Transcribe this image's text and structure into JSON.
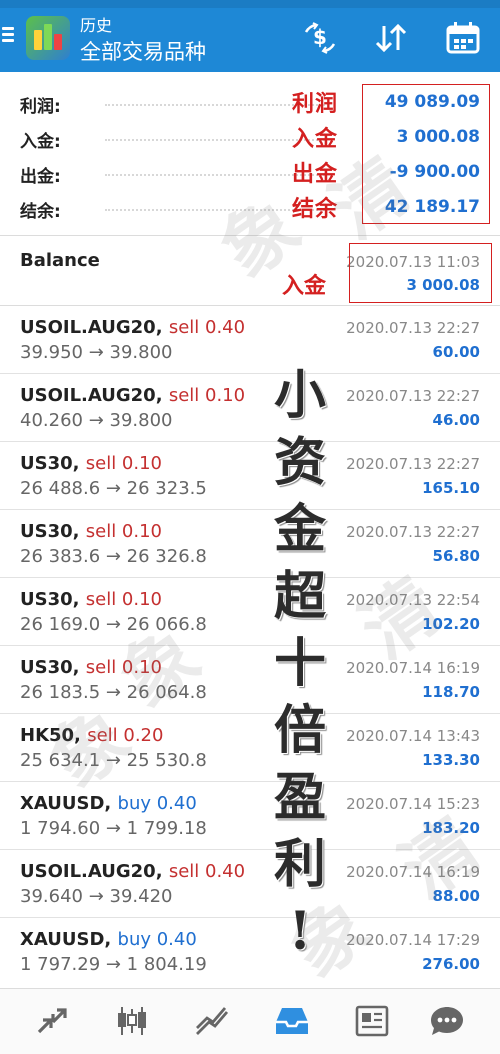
{
  "header": {
    "title_small": "历史",
    "title_big": "全部交易品种",
    "icons": [
      "menu-icon",
      "app-logo",
      "currency-transfer-icon",
      "sort-icon",
      "calendar-icon"
    ]
  },
  "summary": {
    "rows": [
      {
        "label": "利润:",
        "annotation": "利润",
        "value": "49 089.09"
      },
      {
        "label": "入金:",
        "annotation": "入金",
        "value": "3 000.08"
      },
      {
        "label": "出金:",
        "annotation": "出金",
        "value": "-9 900.00"
      },
      {
        "label": "结余:",
        "annotation": "结余",
        "value": "42 189.17"
      }
    ]
  },
  "balance": {
    "title": "Balance",
    "date": "2020.07.13 11:03",
    "value": "3 000.08",
    "annotation": "入金"
  },
  "trades": [
    {
      "symbol": "USOIL.AUG20,",
      "side": "sell 0.40",
      "prices": "39.950 → 39.800",
      "date": "2020.07.13 22:27",
      "profit": "60.00"
    },
    {
      "symbol": "USOIL.AUG20,",
      "side": "sell 0.10",
      "prices": "40.260 → 39.800",
      "date": "2020.07.13 22:27",
      "profit": "46.00"
    },
    {
      "symbol": "US30,",
      "side": "sell 0.10",
      "prices": "26 488.6 → 26 323.5",
      "date": "2020.07.13 22:27",
      "profit": "165.10"
    },
    {
      "symbol": "US30,",
      "side": "sell 0.10",
      "prices": "26 383.6 → 26 326.8",
      "date": "2020.07.13 22:27",
      "profit": "56.80"
    },
    {
      "symbol": "US30,",
      "side": "sell 0.10",
      "prices": "26 169.0 → 26 066.8",
      "date": "2020.07.13 22:54",
      "profit": "102.20"
    },
    {
      "symbol": "US30,",
      "side": "sell 0.10",
      "prices": "26 183.5 → 26 064.8",
      "date": "2020.07.14 16:19",
      "profit": "118.70"
    },
    {
      "symbol": "HK50,",
      "side": "sell 0.20",
      "prices": "25 634.1 → 25 530.8",
      "date": "2020.07.14 13:43",
      "profit": "133.30"
    },
    {
      "symbol": "XAUUSD,",
      "side": "buy 0.40",
      "prices": "1 794.60 → 1 799.18",
      "date": "2020.07.14 15:23",
      "profit": "183.20"
    },
    {
      "symbol": "USOIL.AUG20,",
      "side": "sell 0.40",
      "prices": "39.640 → 39.420",
      "date": "2020.07.14 16:19",
      "profit": "88.00"
    },
    {
      "symbol": "XAUUSD,",
      "side": "buy 0.40",
      "prices": "1 797.29 → 1 804.19",
      "date": "2020.07.14 17:29",
      "profit": "276.00"
    }
  ],
  "overlay_slogan": [
    "小",
    "资",
    "金",
    "超",
    "十",
    "倍",
    "盈",
    "利",
    "!"
  ],
  "colors": {
    "header_bg": "#1e88d6",
    "profit_blue": "#1f6fd0",
    "sell_red": "#c43030",
    "annotation_red": "#d42020",
    "nav_active": "#2f8fe0"
  },
  "bottom_nav": [
    "quotes-icon",
    "chart-icon",
    "trade-icon",
    "history-icon",
    "news-icon",
    "messages-icon"
  ]
}
